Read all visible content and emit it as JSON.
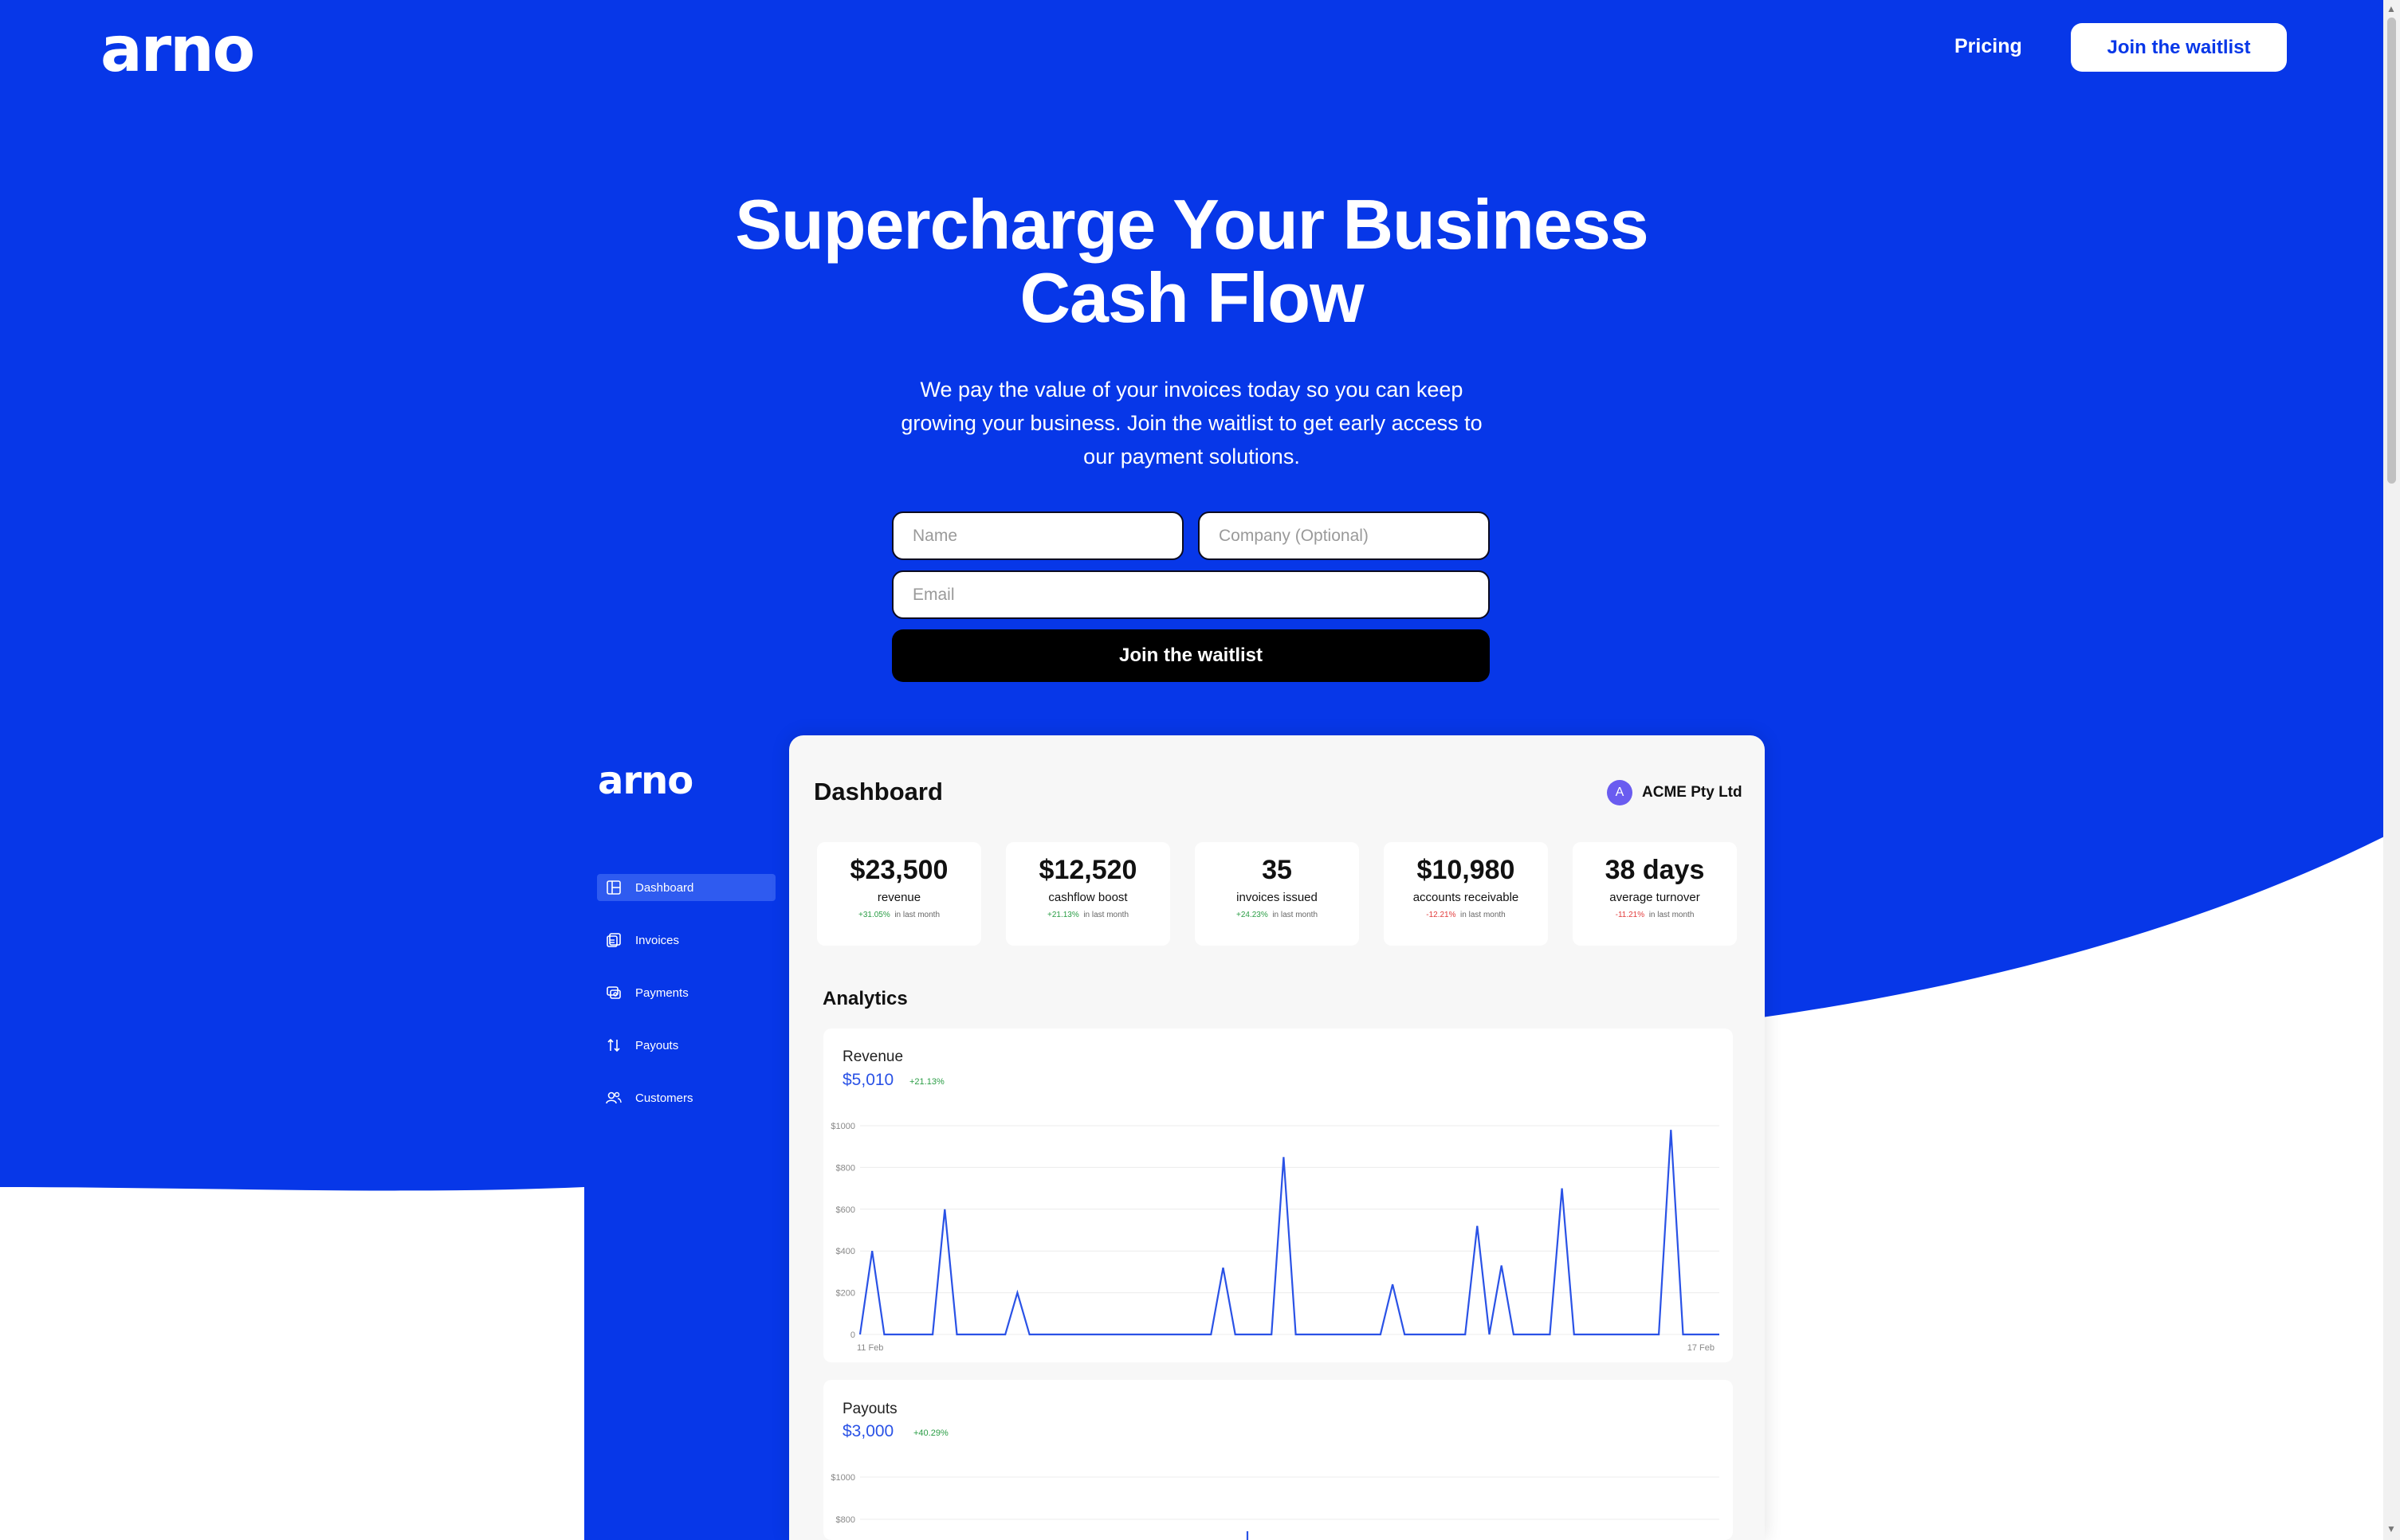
{
  "brand": {
    "logo": "arno",
    "color": "#0737e8"
  },
  "nav": {
    "pricing": "Pricing",
    "join": "Join the waitlist"
  },
  "hero": {
    "title_line1": "Supercharge Your Business",
    "title_line2": "Cash Flow",
    "subtitle": "We pay the value of your invoices today so you can keep growing your business. Join the waitlist to get early access to our payment solutions."
  },
  "form": {
    "name_placeholder": "Name",
    "company_placeholder": "Company (Optional)",
    "email_placeholder": "Email",
    "submit": "Join the waitlist"
  },
  "dashboard": {
    "logo": "arno",
    "title": "Dashboard",
    "company": {
      "initial": "A",
      "name": "ACME Pty Ltd"
    },
    "sidebar": [
      {
        "label": "Dashboard",
        "icon": "dashboard-icon",
        "active": true
      },
      {
        "label": "Invoices",
        "icon": "invoices-icon",
        "active": false
      },
      {
        "label": "Payments",
        "icon": "payments-icon",
        "active": false
      },
      {
        "label": "Payouts",
        "icon": "payouts-icon",
        "active": false
      },
      {
        "label": "Customers",
        "icon": "customers-icon",
        "active": false
      }
    ],
    "stats": [
      {
        "value": "$23,500",
        "label": "revenue",
        "change": "+31.05%",
        "trend": "up",
        "period": "in last month"
      },
      {
        "value": "$12,520",
        "label": "cashflow boost",
        "change": "+21.13%",
        "trend": "up",
        "period": "in last month"
      },
      {
        "value": "35",
        "label": "invoices issued",
        "change": "+24.23%",
        "trend": "up",
        "period": "in last month"
      },
      {
        "value": "$10,980",
        "label": "accounts receivable",
        "change": "-12.21%",
        "trend": "down",
        "period": "in last month"
      },
      {
        "value": "38 days",
        "label": "average turnover",
        "change": "-11.21%",
        "trend": "down",
        "period": "in last month"
      }
    ],
    "analytics_title": "Analytics",
    "revenue": {
      "name": "Revenue",
      "value": "$5,010",
      "change": "+21.13%"
    },
    "payouts": {
      "name": "Payouts",
      "value": "$3,000",
      "change": "+40.29%"
    }
  },
  "chart_data": [
    {
      "type": "line",
      "title": "Revenue",
      "y_ticks": [
        "0",
        "$200",
        "$400",
        "$600",
        "$800",
        "$1000"
      ],
      "ylim": [
        0,
        1000
      ],
      "x_labels": [
        "11 Feb",
        "17 Feb"
      ],
      "series": [
        {
          "color": "#2a52e6",
          "values": [
            0,
            400,
            0,
            0,
            0,
            0,
            0,
            600,
            0,
            0,
            0,
            0,
            0,
            200,
            0,
            0,
            0,
            0,
            0,
            0,
            0,
            0,
            0,
            0,
            0,
            0,
            0,
            0,
            0,
            0,
            320,
            0,
            0,
            0,
            0,
            850,
            0,
            0,
            0,
            0,
            0,
            0,
            0,
            0,
            240,
            0,
            0,
            0,
            0,
            0,
            0,
            520,
            0,
            330,
            0,
            0,
            0,
            0,
            700,
            0,
            0,
            0,
            0,
            0,
            0,
            0,
            0,
            980,
            0,
            0,
            0,
            0
          ]
        }
      ]
    },
    {
      "type": "line",
      "title": "Payouts",
      "y_ticks": [
        "$800",
        "$1000"
      ],
      "ylim": [
        0,
        1000
      ],
      "series": [
        {
          "color": "#2a52e6",
          "values": []
        }
      ]
    }
  ]
}
